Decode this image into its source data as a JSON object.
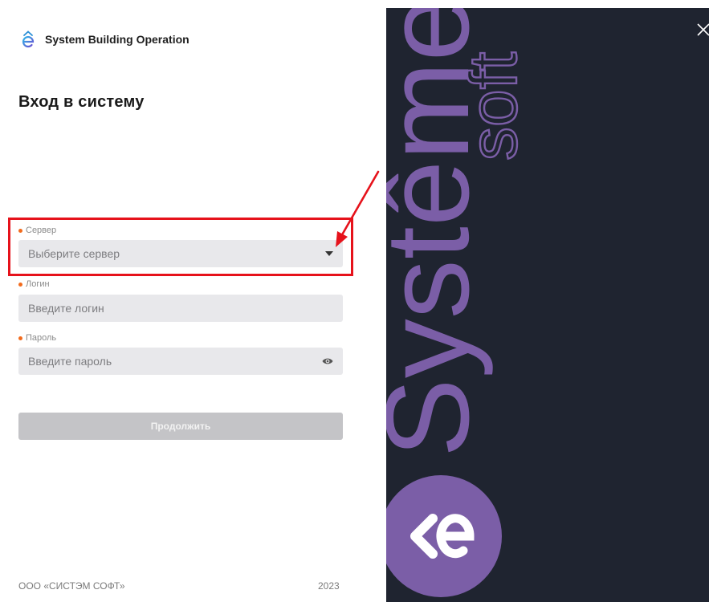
{
  "brand": {
    "name": "System Building Operation"
  },
  "page": {
    "title": "Вход в систему"
  },
  "form": {
    "server": {
      "label": "Сервер",
      "placeholder": "Выберите сервер"
    },
    "login": {
      "label": "Логин",
      "placeholder": "Введите логин"
    },
    "password": {
      "label": "Пароль",
      "placeholder": "Введите пароль"
    },
    "submit_label": "Продолжить"
  },
  "footer": {
    "company": "ООО «СИСТЭМ СОФТ»",
    "year": "2023"
  },
  "side_panel": {
    "logo_text": "Systême",
    "logo_sub": "soft"
  },
  "colors": {
    "accent": "#7b5ea7",
    "panel_bg": "#1f2430",
    "required_dot": "#f26b1d",
    "annotation": "#e6121b"
  },
  "icons": [
    "brand-logo-icon",
    "chevron-down-icon",
    "eye-icon",
    "close-icon"
  ]
}
